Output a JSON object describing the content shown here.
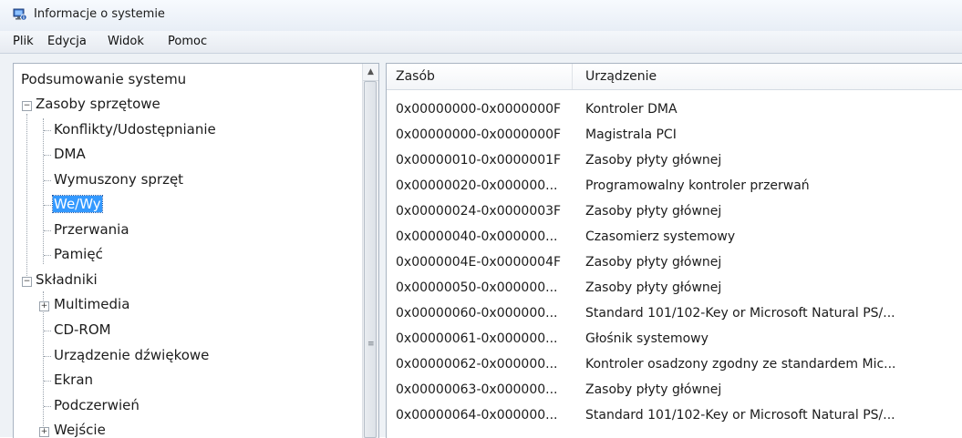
{
  "window": {
    "title": "Informacje o systemie"
  },
  "menu": [
    "Plik",
    "Edycja",
    "Widok",
    "Pomoc"
  ],
  "tree": {
    "items": [
      {
        "label": "Podsumowanie systemu"
      },
      {
        "label": "Zasoby sprzętowe",
        "expander": "−"
      },
      {
        "label": "Konflikty/Udostępnianie"
      },
      {
        "label": "DMA"
      },
      {
        "label": "Wymuszony sprzęt"
      },
      {
        "label": "We/Wy",
        "selected": true
      },
      {
        "label": "Przerwania"
      },
      {
        "label": "Pamięć"
      },
      {
        "label": "Składniki",
        "expander": "−"
      },
      {
        "label": "Multimedia",
        "expander": "+"
      },
      {
        "label": "CD-ROM"
      },
      {
        "label": "Urządzenie dźwiękowe"
      },
      {
        "label": "Ekran"
      },
      {
        "label": "Podczerwień"
      },
      {
        "label": "Wejście",
        "expander": "+"
      }
    ]
  },
  "table": {
    "columns": [
      "Zasób",
      "Urządzenie"
    ],
    "rows": [
      [
        "0x00000000-0x0000000F",
        "Kontroler DMA"
      ],
      [
        "0x00000000-0x0000000F",
        "Magistrala PCI"
      ],
      [
        "0x00000010-0x0000001F",
        "Zasoby płyty głównej"
      ],
      [
        "0x00000020-0x000000...",
        "Programowalny kontroler przerwań"
      ],
      [
        "0x00000024-0x0000003F",
        "Zasoby płyty głównej"
      ],
      [
        "0x00000040-0x000000...",
        "Czasomierz systemowy"
      ],
      [
        "0x0000004E-0x0000004F",
        "Zasoby płyty głównej"
      ],
      [
        "0x00000050-0x000000...",
        "Zasoby płyty głównej"
      ],
      [
        "0x00000060-0x000000...",
        "Standard 101/102-Key or Microsoft Natural PS/..."
      ],
      [
        "0x00000061-0x000000...",
        "Głośnik systemowy"
      ],
      [
        "0x00000062-0x000000...",
        "Kontroler osadzony zgodny ze standardem Mic..."
      ],
      [
        "0x00000063-0x000000...",
        "Zasoby płyty głównej"
      ],
      [
        "0x00000064-0x000000...",
        "Standard 101/102-Key or Microsoft Natural PS/..."
      ]
    ]
  },
  "colors": {
    "selection": "#3399ff",
    "border": "#a9b4c2"
  }
}
